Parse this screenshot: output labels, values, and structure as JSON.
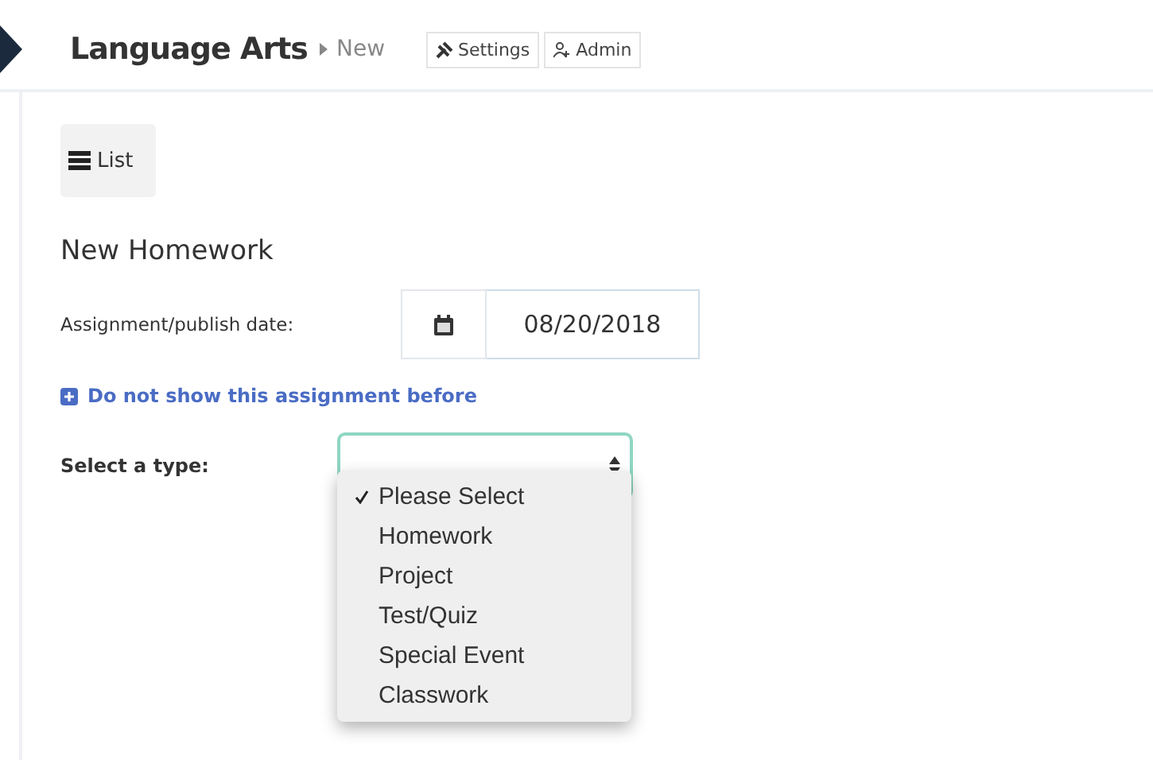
{
  "header": {
    "title": "Language Arts",
    "crumb": "New",
    "buttons": [
      {
        "kind": "settings",
        "label": "Settings"
      },
      {
        "kind": "admin",
        "label": "Admin"
      }
    ]
  },
  "list_button": {
    "label": "List"
  },
  "form": {
    "heading": "New Homework",
    "date_label": "Assignment/publish date:",
    "date_value": "08/20/2018",
    "hide_link": "Do not show this assignment before",
    "type_label": "Select a type:",
    "type_options": [
      {
        "label": "Please Select",
        "selected": true
      },
      {
        "label": "Homework",
        "selected": false
      },
      {
        "label": "Project",
        "selected": false
      },
      {
        "label": "Test/Quiz",
        "selected": false
      },
      {
        "label": "Special Event",
        "selected": false
      },
      {
        "label": "Classwork",
        "selected": false
      }
    ]
  }
}
